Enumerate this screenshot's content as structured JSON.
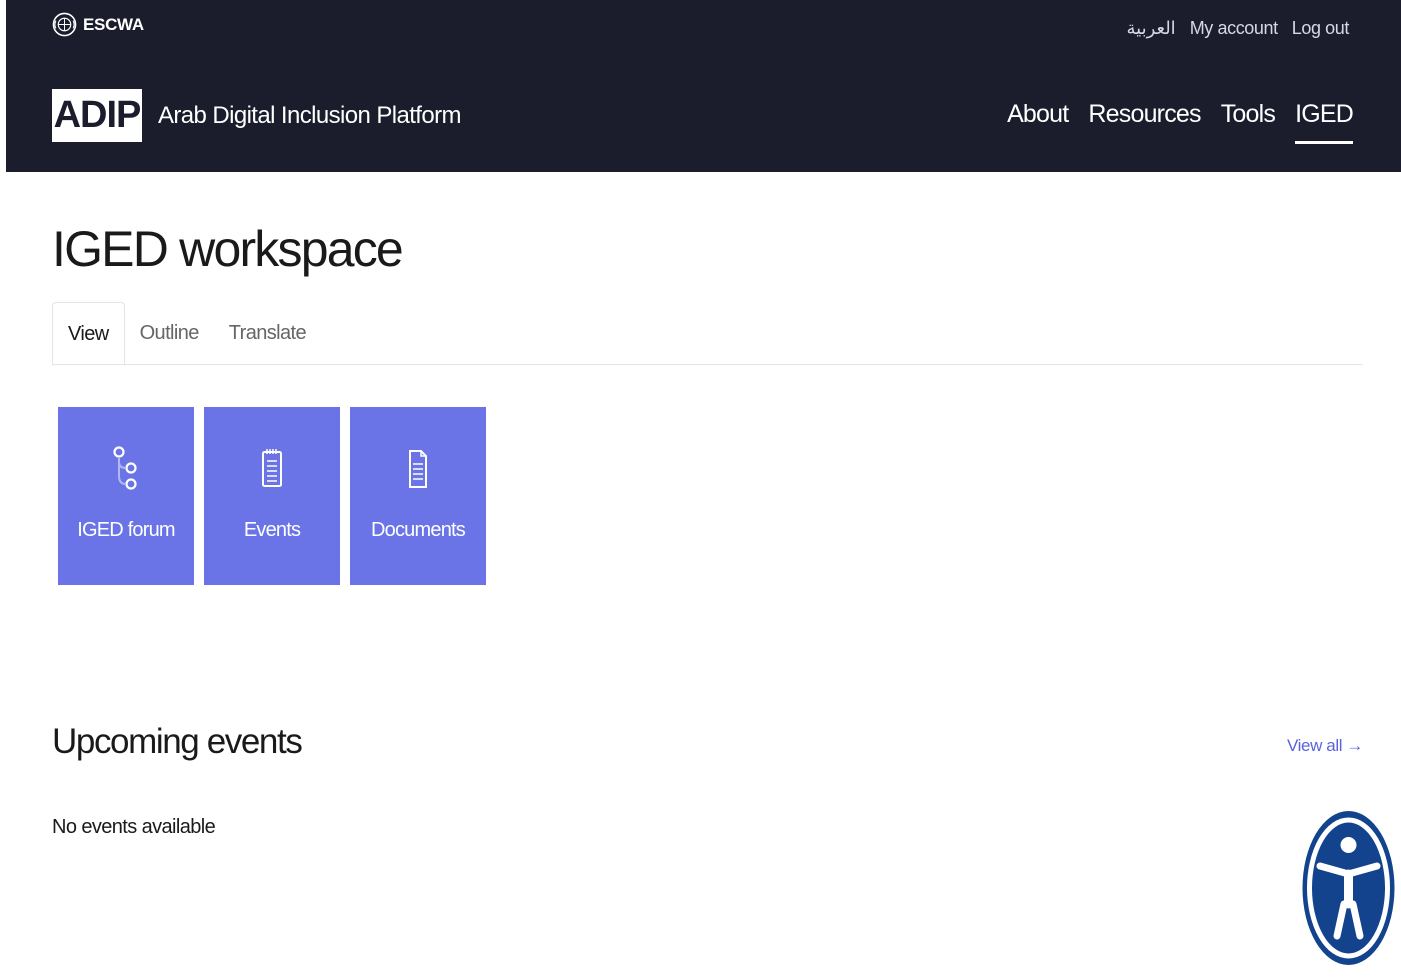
{
  "header": {
    "org_name": "ESCWA",
    "util_links": [
      "العربية",
      "My account",
      "Log out"
    ],
    "logo_text": "ADIP",
    "platform_name": "Arab Digital Inclusion Platform",
    "main_nav": [
      "About",
      "Resources",
      "Tools",
      "IGED"
    ],
    "main_nav_active": "IGED"
  },
  "page": {
    "title": "IGED workspace",
    "tabs": [
      "View",
      "Outline",
      "Translate"
    ],
    "active_tab": "View"
  },
  "tiles": [
    {
      "label": "IGED forum",
      "icon": "forum-network-icon"
    },
    {
      "label": "Events",
      "icon": "events-notepad-icon"
    },
    {
      "label": "Documents",
      "icon": "document-icon"
    }
  ],
  "upcoming": {
    "title": "Upcoming events",
    "view_all": "View all →",
    "empty_text": "No events available"
  },
  "colors": {
    "header_bg": "#1b1c2c",
    "tile_bg": "#6a74e6",
    "link": "#5a63dd",
    "a11y_blue": "#12438c"
  }
}
